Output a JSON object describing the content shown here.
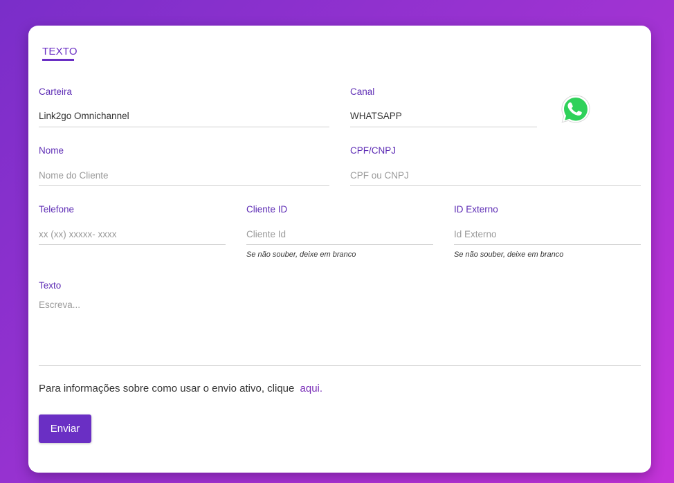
{
  "tabs": [
    {
      "label": "TEXTO",
      "active": true
    }
  ],
  "form": {
    "carteira": {
      "label": "Carteira",
      "value": "Link2go Omnichannel"
    },
    "canal": {
      "label": "Canal",
      "value": "WHATSAPP",
      "icon": "whatsapp-icon"
    },
    "nome": {
      "label": "Nome",
      "placeholder": "Nome do Cliente"
    },
    "cpf": {
      "label": "CPF/CNPJ",
      "placeholder": "CPF ou CNPJ"
    },
    "telefone": {
      "label": "Telefone",
      "placeholder": "xx (xx) xxxxx- xxxx"
    },
    "cliente_id": {
      "label": "Cliente ID",
      "placeholder": "Cliente Id",
      "hint": "Se não souber, deixe em branco"
    },
    "id_externo": {
      "label": "ID Externo",
      "placeholder": "Id Externo",
      "hint": "Se não souber, deixe em branco"
    },
    "texto": {
      "label": "Texto",
      "placeholder": "Escreva..."
    }
  },
  "info": {
    "text": "Para informações sobre como usar o envio ativo, clique",
    "link_label": "aqui."
  },
  "submit_label": "Enviar",
  "colors": {
    "accent": "#6a2fc4",
    "background_start": "#7a2ec9",
    "background_end": "#c433d8",
    "whatsapp_green": "#25d366"
  }
}
